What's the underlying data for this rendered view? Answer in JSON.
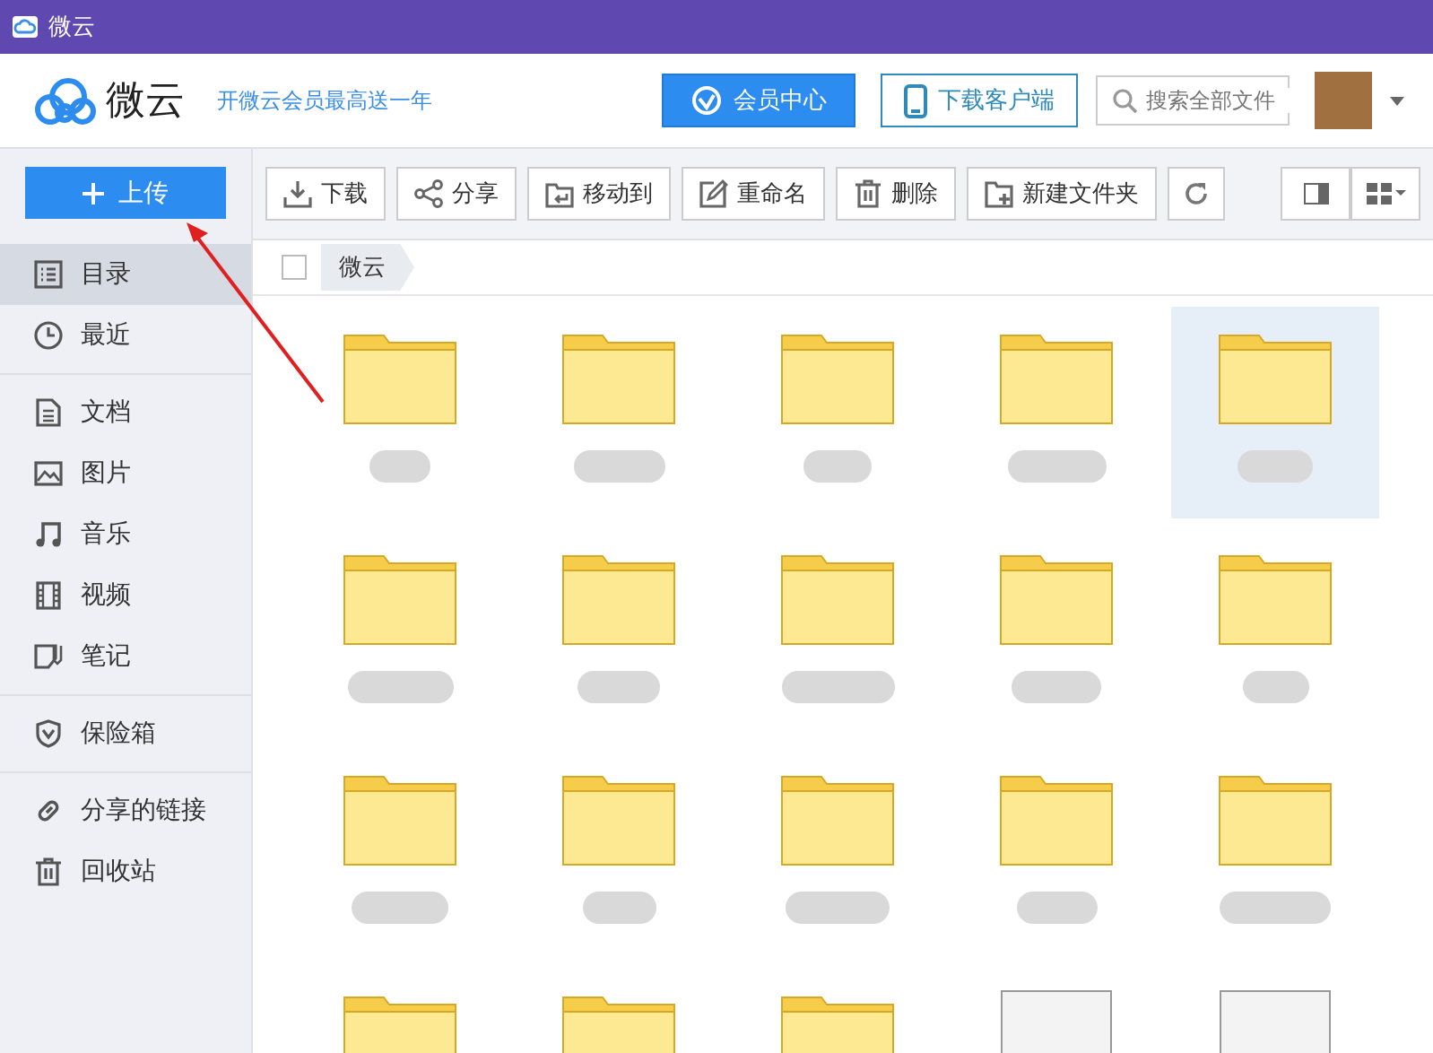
{
  "window": {
    "title": "微云"
  },
  "header": {
    "logo_text": "微云",
    "promo": "开微云会员最高送一年",
    "vip_button": "会员中心",
    "client_button": "下载客户端",
    "search": {
      "placeholder": "搜索全部文件"
    }
  },
  "sidebar": {
    "upload_button": "上传",
    "groups": [
      [
        {
          "kind": "list",
          "label": "目录",
          "selected": true
        },
        {
          "kind": "clock",
          "label": "最近",
          "selected": false
        }
      ],
      [
        {
          "kind": "doc",
          "label": "文档",
          "selected": false
        },
        {
          "kind": "image",
          "label": "图片",
          "selected": false
        },
        {
          "kind": "music",
          "label": "音乐",
          "selected": false
        },
        {
          "kind": "video",
          "label": "视频",
          "selected": false
        },
        {
          "kind": "note",
          "label": "笔记",
          "selected": false
        }
      ],
      [
        {
          "kind": "shield",
          "label": "保险箱",
          "selected": false
        }
      ],
      [
        {
          "kind": "link",
          "label": "分享的链接",
          "selected": false
        },
        {
          "kind": "trash",
          "label": "回收站",
          "selected": false
        }
      ]
    ]
  },
  "toolbar": [
    {
      "kind": "download",
      "label": "下载"
    },
    {
      "kind": "share",
      "label": "分享"
    },
    {
      "kind": "move",
      "label": "移动到"
    },
    {
      "kind": "rename",
      "label": "重命名"
    },
    {
      "kind": "delete",
      "label": "删除"
    },
    {
      "kind": "newfolder",
      "label": "新建文件夹"
    },
    {
      "kind": "refresh"
    }
  ],
  "select_all": {
    "checked": false
  },
  "breadcrumb": [
    "微云"
  ],
  "items": [
    {
      "kind": "folder",
      "selected": false
    },
    {
      "kind": "folder",
      "selected": false
    },
    {
      "kind": "folder",
      "selected": false
    },
    {
      "kind": "folder",
      "selected": false
    },
    {
      "kind": "folder",
      "selected": true
    },
    {
      "kind": "folder",
      "selected": false
    },
    {
      "kind": "folder",
      "selected": false
    },
    {
      "kind": "folder",
      "selected": false
    },
    {
      "kind": "folder",
      "selected": false
    },
    {
      "kind": "folder",
      "selected": false
    },
    {
      "kind": "folder",
      "selected": false
    },
    {
      "kind": "folder",
      "selected": false
    },
    {
      "kind": "folder",
      "selected": false
    },
    {
      "kind": "folder",
      "selected": false
    },
    {
      "kind": "folder",
      "selected": false
    },
    {
      "kind": "folder",
      "selected": false
    },
    {
      "kind": "folder",
      "selected": false
    },
    {
      "kind": "folder",
      "selected": false
    },
    {
      "kind": "file",
      "selected": false
    },
    {
      "kind": "file",
      "selected": false
    }
  ]
}
